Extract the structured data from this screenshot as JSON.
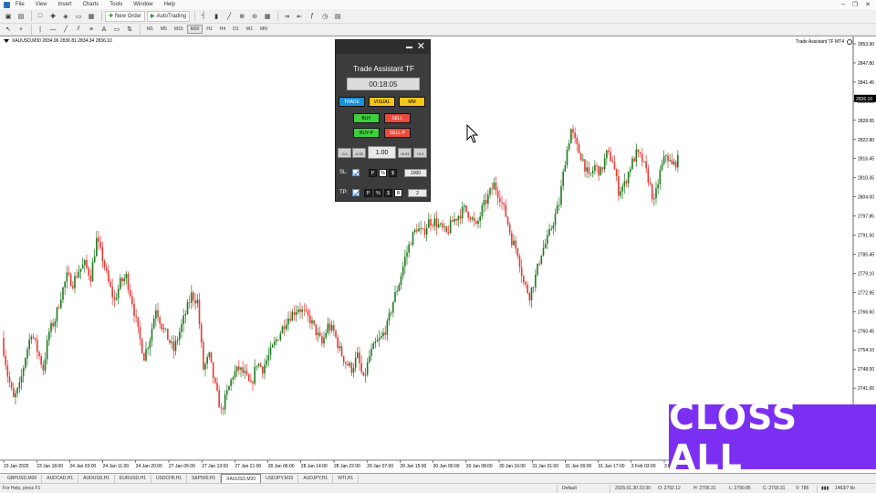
{
  "menu": [
    "File",
    "View",
    "Insert",
    "Charts",
    "Tools",
    "Window",
    "Help"
  ],
  "toolbar": {
    "new_order": "New Order",
    "autotrading": "AutoTrading",
    "timeframes": [
      "M1",
      "M5",
      "M15",
      "M30",
      "H1",
      "H4",
      "D1",
      "W1",
      "MN"
    ],
    "active_timeframe": "M30"
  },
  "chart": {
    "symbol_info": "XAUUSD,M30  2834.96 2836.81 2834.34 2836.10",
    "ea_label": "Trade Assistant TF MT4",
    "current_price": "2836.10",
    "bull_color": "#1f7a1f",
    "bear_color": "#e53935"
  },
  "chart_data": {
    "type": "candlestick",
    "symbol": "XAUUSD",
    "timeframe": "M30",
    "y_ticks": [
      "2853.90",
      "2847.80",
      "2841.45",
      "2835.30",
      "2828.95",
      "2822.80",
      "2816.45",
      "2810.35",
      "2804.00",
      "2797.85",
      "2791.50",
      "2785.45",
      "2779.10",
      "2772.95",
      "2766.60",
      "2760.45",
      "2754.10",
      "2748.00",
      "2741.65",
      "2735.50",
      "2729.15",
      "2722.95"
    ],
    "x_ticks": [
      "23 Jan 2025",
      "23 Jan 18:00",
      "24 Jan 03:00",
      "24 Jan 11:00",
      "24 Jan 20:00",
      "27 Jan 05:00",
      "27 Jan 13:00",
      "27 Jan 21:00",
      "28 Jan 06:00",
      "28 Jan 14:00",
      "28 Jan 22:00",
      "29 Jan 07:00",
      "29 Jan 15:00",
      "30 Jan 00:00",
      "30 Jan 08:00",
      "30 Jan 16:00",
      "31 Jan 01:00",
      "31 Jan 09:00",
      "31 Jan 17:00",
      "3 Feb 03:00",
      "3 Feb 11:00",
      "3 Feb 19:00",
      "4 Feb 04:00"
    ],
    "ylim": [
      2722.95,
      2853.9
    ],
    "path_prices": [
      2758,
      2746,
      2738,
      2742,
      2752,
      2760,
      2754,
      2748,
      2760,
      2764,
      2772,
      2778,
      2776,
      2780,
      2782,
      2778,
      2790,
      2784,
      2776,
      2770,
      2776,
      2778,
      2770,
      2760,
      2752,
      2758,
      2768,
      2762,
      2758,
      2754,
      2760,
      2766,
      2772,
      2770,
      2748,
      2752,
      2742,
      2734,
      2740,
      2746,
      2748,
      2746,
      2742,
      2750,
      2748,
      2752,
      2756,
      2760,
      2764,
      2766,
      2768,
      2766,
      2764,
      2760,
      2756,
      2762,
      2760,
      2754,
      2750,
      2748,
      2752,
      2744,
      2752,
      2756,
      2758,
      2762,
      2770,
      2776,
      2784,
      2790,
      2794,
      2792,
      2796,
      2796,
      2794,
      2792,
      2796,
      2798,
      2800,
      2798,
      2794,
      2800,
      2804,
      2808,
      2804,
      2798,
      2790,
      2786,
      2776,
      2772,
      2778,
      2786,
      2790,
      2796,
      2802,
      2816,
      2826,
      2820,
      2816,
      2810,
      2814,
      2812,
      2818,
      2816,
      2806,
      2808,
      2814,
      2818,
      2816,
      2810,
      2802,
      2812,
      2818,
      2814,
      2816
    ]
  },
  "trade_assistant": {
    "title": "Trade Assistant TF",
    "timer": "00:18:05",
    "tab_trade": "TRADE",
    "tab_visual": "VISUAL",
    "tab_mm": "MM",
    "buy": "BUY",
    "sell": "SELL",
    "buy_p": "BUY-P",
    "sell_p": "SELL-P",
    "lot_minus_big": "-0.1",
    "lot_minus_small": "-0.01",
    "lot_value": "1.00",
    "lot_plus_small": "+0.01",
    "lot_plus_big": "+0.1",
    "sl_label": "SL:",
    "tp_label": "TP:",
    "mode_p": "P",
    "mode_pct": "%",
    "mode_dollar": "$",
    "mode_r": "R",
    "sl_value": "1000",
    "tp_value": "2",
    "colors": {
      "trade_tab": "#1e90d8",
      "visual_tab": "#f5c518",
      "mm_tab": "#f5c518",
      "buy": "#3ecf3e",
      "sell": "#e94b3c"
    }
  },
  "overlay": {
    "text": "CLOSS ALL",
    "color": "#7b2ff2"
  },
  "tabs": [
    "GBPUSD,M30",
    "AUDCAD,H1",
    "AUDUSD,H1",
    "EURUSD,H1",
    "USDCHF,H1",
    "S&P500,H1",
    "XAUUSD,M30",
    "USDJPY,M15",
    "AUDJPY,H1",
    "WTI,H1"
  ],
  "active_tab": "XAUUSD,M30",
  "status": {
    "help": "For Help, press F1",
    "profile": "Default",
    "datetime": "2025.01.30 23:30",
    "open": "O: 2792.12",
    "high": "H: 2795.31",
    "low": "L: 2790.85",
    "close": "C: 2793.31",
    "volume": "V: 785",
    "traffic": "1463/7 kb"
  }
}
